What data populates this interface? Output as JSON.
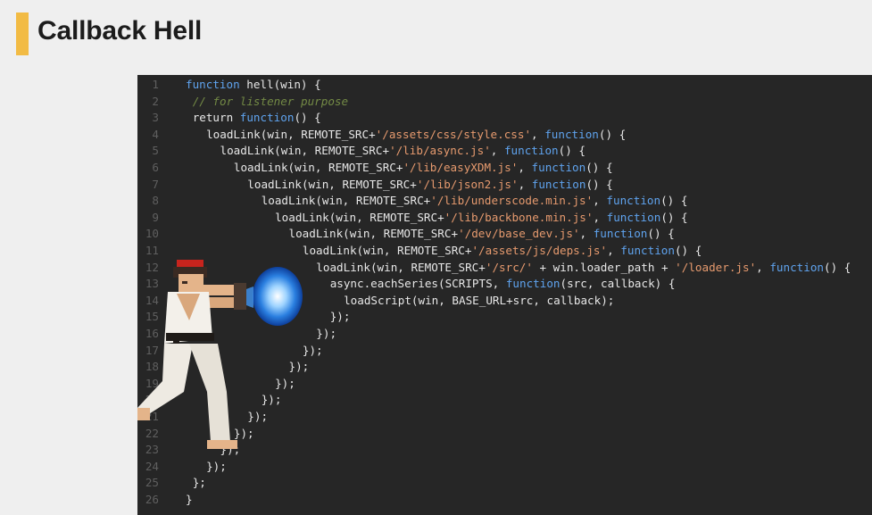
{
  "slide": {
    "title": "Callback Hell",
    "accent_color": "#f2bb44"
  },
  "code": {
    "background": "#262626",
    "colors": {
      "keyword": "#5fa3ee",
      "string": "#e69a6e",
      "comment": "#738a45",
      "text": "#e7e7e7",
      "line_number": "#5f5f5f"
    },
    "lines": [
      {
        "n": "1",
        "indent": 0,
        "tokens": [
          {
            "t": "kw",
            "v": "function"
          },
          {
            "t": "id",
            "v": " hell(win) {"
          }
        ]
      },
      {
        "n": "2",
        "indent": 1,
        "tokens": [
          {
            "t": "cmt",
            "v": "// for listener purpose"
          }
        ]
      },
      {
        "n": "3",
        "indent": 1,
        "tokens": [
          {
            "t": "id",
            "v": "return "
          },
          {
            "t": "kw",
            "v": "function"
          },
          {
            "t": "id",
            "v": "() {"
          }
        ]
      },
      {
        "n": "4",
        "indent": 3,
        "tokens": [
          {
            "t": "id",
            "v": "loadLink(win, REMOTE_SRC+"
          },
          {
            "t": "str",
            "v": "'/assets/css/style.css'"
          },
          {
            "t": "id",
            "v": ", "
          },
          {
            "t": "kw",
            "v": "function"
          },
          {
            "t": "id",
            "v": "() {"
          }
        ]
      },
      {
        "n": "5",
        "indent": 5,
        "tokens": [
          {
            "t": "id",
            "v": "loadLink(win, REMOTE_SRC+"
          },
          {
            "t": "str",
            "v": "'/lib/async.js'"
          },
          {
            "t": "id",
            "v": ", "
          },
          {
            "t": "kw",
            "v": "function"
          },
          {
            "t": "id",
            "v": "() {"
          }
        ]
      },
      {
        "n": "6",
        "indent": 7,
        "tokens": [
          {
            "t": "id",
            "v": "loadLink(win, REMOTE_SRC+"
          },
          {
            "t": "str",
            "v": "'/lib/easyXDM.js'"
          },
          {
            "t": "id",
            "v": ", "
          },
          {
            "t": "kw",
            "v": "function"
          },
          {
            "t": "id",
            "v": "() {"
          }
        ]
      },
      {
        "n": "7",
        "indent": 9,
        "tokens": [
          {
            "t": "id",
            "v": "loadLink(win, REMOTE_SRC+"
          },
          {
            "t": "str",
            "v": "'/lib/json2.js'"
          },
          {
            "t": "id",
            "v": ", "
          },
          {
            "t": "kw",
            "v": "function"
          },
          {
            "t": "id",
            "v": "() {"
          }
        ]
      },
      {
        "n": "8",
        "indent": 11,
        "tokens": [
          {
            "t": "id",
            "v": "loadLink(win, REMOTE_SRC+"
          },
          {
            "t": "str",
            "v": "'/lib/underscode.min.js'"
          },
          {
            "t": "id",
            "v": ", "
          },
          {
            "t": "kw",
            "v": "function"
          },
          {
            "t": "id",
            "v": "() {"
          }
        ]
      },
      {
        "n": "9",
        "indent": 13,
        "tokens": [
          {
            "t": "id",
            "v": "loadLink(win, REMOTE_SRC+"
          },
          {
            "t": "str",
            "v": "'/lib/backbone.min.js'"
          },
          {
            "t": "id",
            "v": ", "
          },
          {
            "t": "kw",
            "v": "function"
          },
          {
            "t": "id",
            "v": "() {"
          }
        ]
      },
      {
        "n": "10",
        "indent": 15,
        "tokens": [
          {
            "t": "id",
            "v": "loadLink(win, REMOTE_SRC+"
          },
          {
            "t": "str",
            "v": "'/dev/base_dev.js'"
          },
          {
            "t": "id",
            "v": ", "
          },
          {
            "t": "kw",
            "v": "function"
          },
          {
            "t": "id",
            "v": "() {"
          }
        ]
      },
      {
        "n": "11",
        "indent": 17,
        "tokens": [
          {
            "t": "id",
            "v": "loadLink(win, REMOTE_SRC+"
          },
          {
            "t": "str",
            "v": "'/assets/js/deps.js'"
          },
          {
            "t": "id",
            "v": ", "
          },
          {
            "t": "kw",
            "v": "function"
          },
          {
            "t": "id",
            "v": "() {"
          }
        ]
      },
      {
        "n": "12",
        "indent": 19,
        "tokens": [
          {
            "t": "id",
            "v": "loadLink(win, REMOTE_SRC+"
          },
          {
            "t": "str",
            "v": "'/src/'"
          },
          {
            "t": "id",
            "v": " + win.loader_path + "
          },
          {
            "t": "str",
            "v": "'/loader.js'"
          },
          {
            "t": "id",
            "v": ", "
          },
          {
            "t": "kw",
            "v": "function"
          },
          {
            "t": "id",
            "v": "() {"
          }
        ]
      },
      {
        "n": "13",
        "indent": 21,
        "tokens": [
          {
            "t": "id",
            "v": "async.eachSeries(SCRIPTS, "
          },
          {
            "t": "kw",
            "v": "function"
          },
          {
            "t": "id",
            "v": "(src, callback) {"
          }
        ]
      },
      {
        "n": "14",
        "indent": 23,
        "tokens": [
          {
            "t": "id",
            "v": "loadScript(win, BASE_URL+src, callback);"
          }
        ]
      },
      {
        "n": "15",
        "indent": 21,
        "tokens": [
          {
            "t": "id",
            "v": "});"
          }
        ]
      },
      {
        "n": "16",
        "indent": 19,
        "tokens": [
          {
            "t": "id",
            "v": "});"
          }
        ]
      },
      {
        "n": "17",
        "indent": 17,
        "tokens": [
          {
            "t": "id",
            "v": "});"
          }
        ]
      },
      {
        "n": "18",
        "indent": 15,
        "tokens": [
          {
            "t": "id",
            "v": "});"
          }
        ]
      },
      {
        "n": "19",
        "indent": 13,
        "tokens": [
          {
            "t": "id",
            "v": "});"
          }
        ]
      },
      {
        "n": "20",
        "indent": 11,
        "tokens": [
          {
            "t": "id",
            "v": "});"
          }
        ]
      },
      {
        "n": "21",
        "indent": 9,
        "tokens": [
          {
            "t": "id",
            "v": "});"
          }
        ]
      },
      {
        "n": "22",
        "indent": 7,
        "tokens": [
          {
            "t": "id",
            "v": "});"
          }
        ]
      },
      {
        "n": "23",
        "indent": 5,
        "tokens": [
          {
            "t": "id",
            "v": "});"
          }
        ]
      },
      {
        "n": "24",
        "indent": 3,
        "tokens": [
          {
            "t": "id",
            "v": "});"
          }
        ]
      },
      {
        "n": "25",
        "indent": 1,
        "tokens": [
          {
            "t": "id",
            "v": "};"
          }
        ]
      },
      {
        "n": "26",
        "indent": 0,
        "tokens": [
          {
            "t": "id",
            "v": "}"
          }
        ]
      }
    ]
  },
  "illustration": {
    "icon": "fighter-hadouken-icon"
  }
}
